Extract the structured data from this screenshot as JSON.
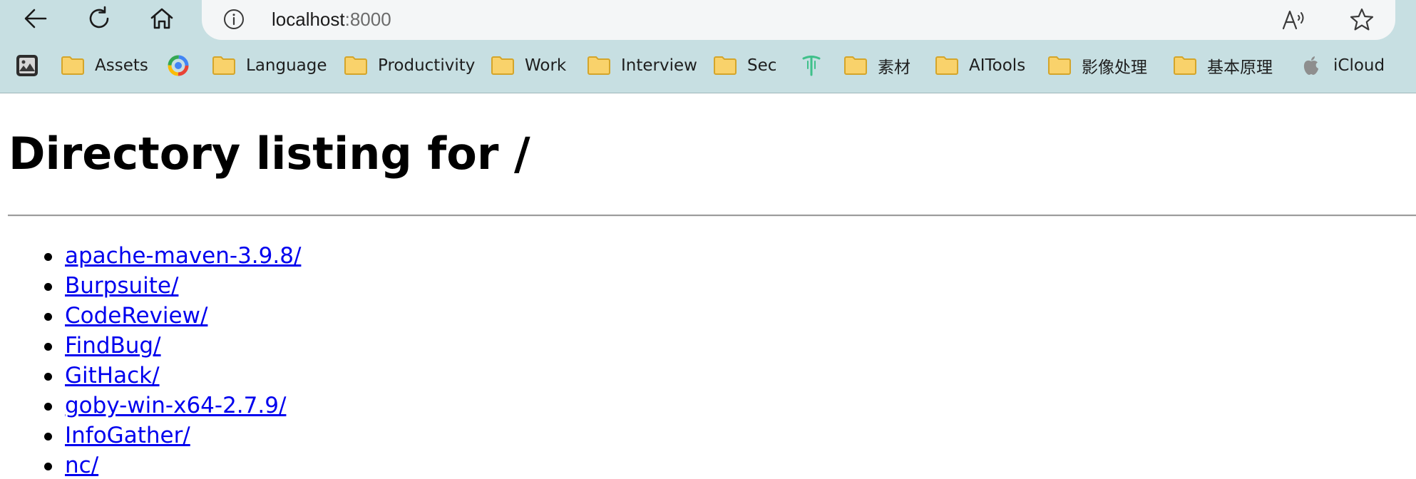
{
  "browser": {
    "url_host": "localhost",
    "url_port": ":8000",
    "bookmarks": [
      {
        "label": "",
        "icon": "gallery-app-icon"
      },
      {
        "label": "Assets",
        "icon": "folder-icon"
      },
      {
        "label": "",
        "icon": "colorful-ring-app-icon"
      },
      {
        "label": "Language",
        "icon": "folder-icon"
      },
      {
        "label": "Productivity",
        "icon": "folder-icon"
      },
      {
        "label": "Work",
        "icon": "folder-icon"
      },
      {
        "label": "Interview",
        "icon": "folder-icon"
      },
      {
        "label": "Sec",
        "icon": "folder-icon"
      },
      {
        "label": "",
        "icon": "green-t-icon"
      },
      {
        "label": "素材",
        "icon": "folder-icon"
      },
      {
        "label": "AITools",
        "icon": "folder-icon"
      },
      {
        "label": "影像处理",
        "icon": "folder-icon"
      },
      {
        "label": "基本原理",
        "icon": "folder-icon"
      },
      {
        "label": "iCloud",
        "icon": "apple-icon"
      }
    ]
  },
  "page": {
    "title": "Directory listing for /",
    "entries": [
      {
        "label": "apache-maven-3.9.8/"
      },
      {
        "label": "Burpsuite/"
      },
      {
        "label": "CodeReview/"
      },
      {
        "label": "FindBug/"
      },
      {
        "label": "GitHack/"
      },
      {
        "label": "goby-win-x64-2.7.9/"
      },
      {
        "label": "InfoGather/"
      },
      {
        "label": "nc/"
      }
    ]
  },
  "colors": {
    "chrome_background": "#c7dfe2",
    "link": "#0000ee",
    "folder_fill": "#f9d26b",
    "folder_stroke": "#d4a52a"
  }
}
